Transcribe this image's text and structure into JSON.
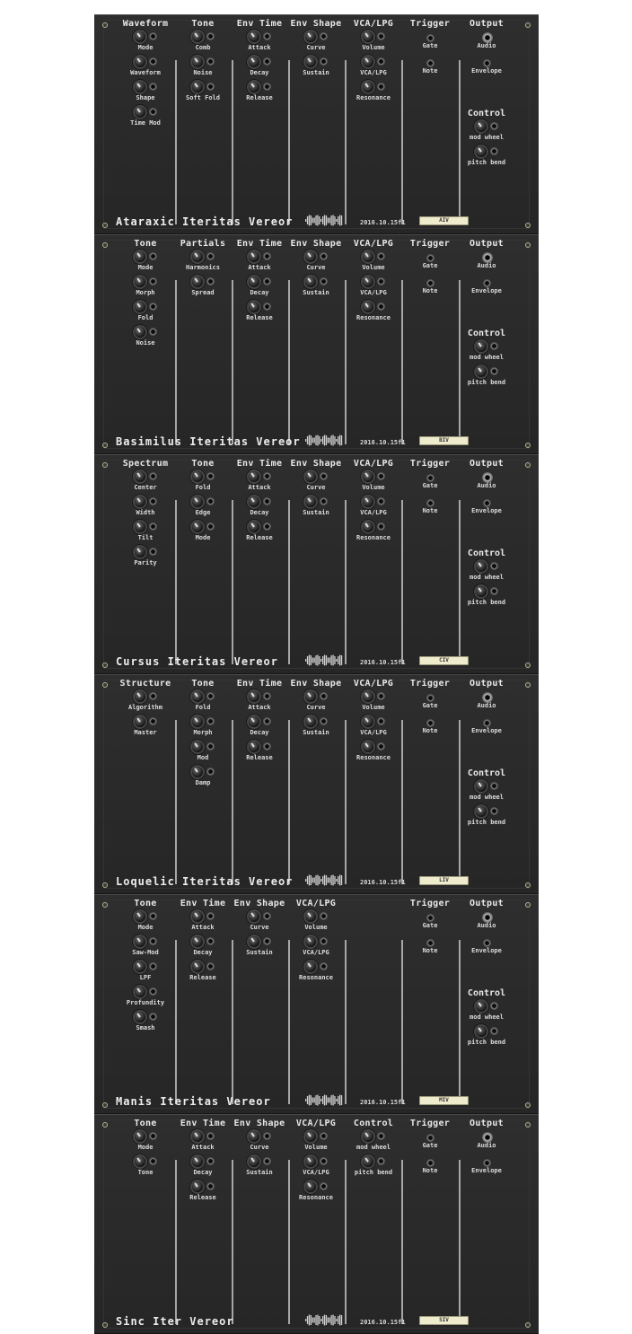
{
  "panels": [
    {
      "name": "Ataraxic Iteritas Vereor",
      "version": "2016.10.15f1",
      "badge": "AIV",
      "columns": [
        {
          "title": "Waveform",
          "controls": [
            "Mode",
            "Waveform",
            "Shape",
            "Time Mod"
          ]
        },
        {
          "title": "Tone",
          "controls": [
            "Comb",
            "Noise",
            "Soft Fold"
          ]
        },
        {
          "title": "Env Time",
          "controls": [
            "Attack",
            "Decay",
            "Release"
          ]
        },
        {
          "title": "Env Shape",
          "controls": [
            "Curve",
            "Sustain"
          ]
        },
        {
          "title": "VCA/LPG",
          "controls": [
            "Volume",
            "VCA/LPG",
            "Resonance"
          ]
        },
        {
          "title": "Trigger",
          "jacks": [
            "Gate",
            "Note"
          ]
        },
        {
          "title": "Output",
          "jacks": [
            "Audio",
            "Envelope"
          ],
          "sub": {
            "title": "Control",
            "controls": [
              "mod wheel",
              "pitch bend"
            ]
          }
        }
      ]
    },
    {
      "name": "Basimilus Iteritas Vereor",
      "version": "2016.10.15f1",
      "badge": "BIV",
      "columns": [
        {
          "title": "Tone",
          "controls": [
            "Mode",
            "Morph",
            "Fold",
            "Noise"
          ]
        },
        {
          "title": "Partials",
          "controls": [
            "Harmonics",
            "Spread"
          ]
        },
        {
          "title": "Env Time",
          "controls": [
            "Attack",
            "Decay",
            "Release"
          ]
        },
        {
          "title": "Env Shape",
          "controls": [
            "Curve",
            "Sustain"
          ]
        },
        {
          "title": "VCA/LPG",
          "controls": [
            "Volume",
            "VCA/LPG",
            "Resonance"
          ]
        },
        {
          "title": "Trigger",
          "jacks": [
            "Gate",
            "Note"
          ]
        },
        {
          "title": "Output",
          "jacks": [
            "Audio",
            "Envelope"
          ],
          "sub": {
            "title": "Control",
            "controls": [
              "mod wheel",
              "pitch bend"
            ]
          }
        }
      ]
    },
    {
      "name": "Cursus Iteritas Vereor",
      "version": "2016.10.15f1",
      "badge": "CIV",
      "columns": [
        {
          "title": "Spectrum",
          "controls": [
            "Center",
            "Width",
            "Tilt",
            "Parity"
          ]
        },
        {
          "title": "Tone",
          "controls": [
            "Fold",
            "Edge",
            "Mode"
          ]
        },
        {
          "title": "Env Time",
          "controls": [
            "Attack",
            "Decay",
            "Release"
          ]
        },
        {
          "title": "Env Shape",
          "controls": [
            "Curve",
            "Sustain"
          ]
        },
        {
          "title": "VCA/LPG",
          "controls": [
            "Volume",
            "VCA/LPG",
            "Resonance"
          ]
        },
        {
          "title": "Trigger",
          "jacks": [
            "Gate",
            "Note"
          ]
        },
        {
          "title": "Output",
          "jacks": [
            "Audio",
            "Envelope"
          ],
          "sub": {
            "title": "Control",
            "controls": [
              "mod wheel",
              "pitch bend"
            ]
          }
        }
      ]
    },
    {
      "name": "Loquelic Iteritas Vereor",
      "version": "2016.10.15f1",
      "badge": "LIV",
      "columns": [
        {
          "title": "Structure",
          "controls": [
            "Algorithm",
            "Master"
          ]
        },
        {
          "title": "Tone",
          "controls": [
            "Fold",
            "Morph",
            "Mod",
            "Damp"
          ]
        },
        {
          "title": "Env Time",
          "controls": [
            "Attack",
            "Decay",
            "Release"
          ]
        },
        {
          "title": "Env Shape",
          "controls": [
            "Curve",
            "Sustain"
          ]
        },
        {
          "title": "VCA/LPG",
          "controls": [
            "Volume",
            "VCA/LPG",
            "Resonance"
          ]
        },
        {
          "title": "Trigger",
          "jacks": [
            "Gate",
            "Note"
          ]
        },
        {
          "title": "Output",
          "jacks": [
            "Audio",
            "Envelope"
          ],
          "sub": {
            "title": "Control",
            "controls": [
              "mod wheel",
              "pitch bend"
            ]
          }
        }
      ]
    },
    {
      "name": "Manis Iteritas Vereor",
      "version": "2016.10.15f1",
      "badge": "MIV",
      "columns": [
        {
          "title": "Tone",
          "controls": [
            "Mode",
            "Saw-Mod",
            "LPF",
            "Profundity",
            "Smash"
          ]
        },
        {
          "title": "Env Time",
          "controls": [
            "Attack",
            "Decay",
            "Release"
          ]
        },
        {
          "title": "Env Shape",
          "controls": [
            "Curve",
            "Sustain"
          ]
        },
        {
          "title": "VCA/LPG",
          "controls": [
            "Volume",
            "VCA/LPG",
            "Resonance"
          ]
        },
        {
          "title": "",
          "controls": []
        },
        {
          "title": "Trigger",
          "jacks": [
            "Gate",
            "Note"
          ]
        },
        {
          "title": "Output",
          "jacks": [
            "Audio",
            "Envelope"
          ],
          "sub": {
            "title": "Control",
            "controls": [
              "mod wheel",
              "pitch bend"
            ]
          }
        }
      ]
    },
    {
      "name": "Sinc Iter Vereor",
      "version": "2016.10.15f1",
      "badge": "SIV",
      "columns": [
        {
          "title": "Tone",
          "controls": [
            "Mode",
            "Tone"
          ]
        },
        {
          "title": "Env Time",
          "controls": [
            "Attack",
            "Decay",
            "Release"
          ]
        },
        {
          "title": "Env Shape",
          "controls": [
            "Curve",
            "Sustain"
          ]
        },
        {
          "title": "VCA/LPG",
          "controls": [
            "Volume",
            "VCA/LPG",
            "Resonance"
          ]
        },
        {
          "title": "Control",
          "controls": [
            "mod wheel",
            "pitch bend"
          ]
        },
        {
          "title": "Trigger",
          "jacks": [
            "Gate",
            "Note"
          ]
        },
        {
          "title": "Output",
          "jacks": [
            "Audio",
            "Envelope"
          ]
        }
      ]
    }
  ]
}
